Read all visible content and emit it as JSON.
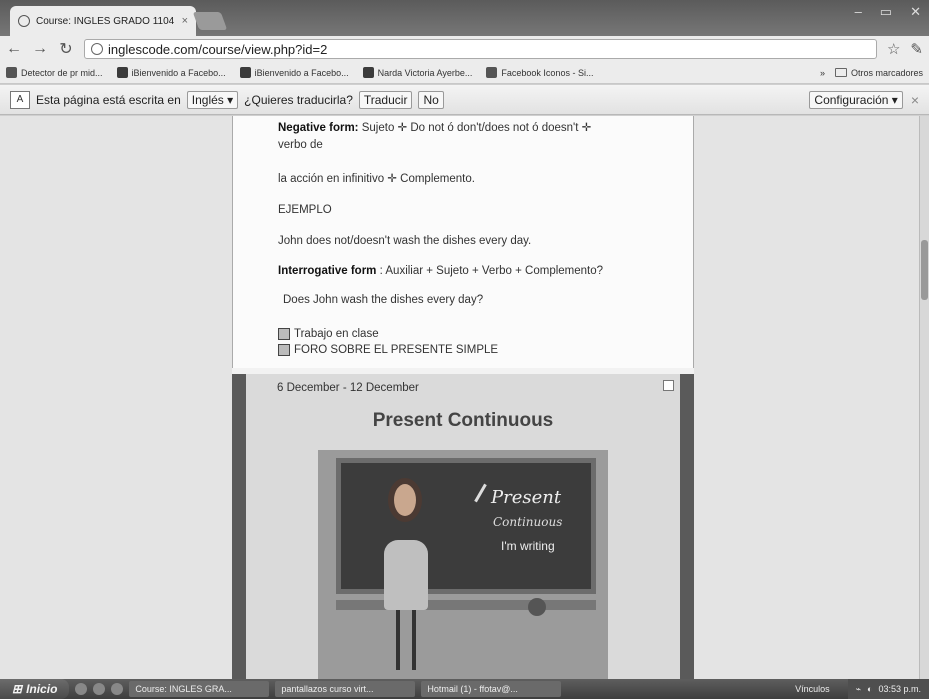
{
  "browser": {
    "tab_title": "Course: INGLES GRADO 1104",
    "tab_close": "×",
    "url": "inglescode.com/course/view.php?id=2",
    "bookmarks": [
      "Detector de pr mid...",
      "iBienvenido a Facebo...",
      "iBienvenido a Facebo...",
      "Narda Victoria Ayerbe...",
      "Facebook Iconos - Si..."
    ],
    "bookmarks_more": "»",
    "other_bookmarks": "Otros marcadores"
  },
  "translate_bar": {
    "icon_text": "A",
    "message": "Esta página está escrita en",
    "language": "Inglés ▾",
    "question": "¿Quieres traducirla?",
    "translate_button": "Traducir",
    "no_button": "No",
    "settings_button": "Configuración ▾",
    "close": "×"
  },
  "section1": {
    "neg_label": "Negative form:",
    "neg_text": " Sujeto ✛ Do not ó don't/does not ó doesn't ✛",
    "neg_text2": "verbo de",
    "line3": "la acción en infinitivo ✛ Complemento.",
    "example_heading": "EJEMPLO",
    "example_line": "John does not/doesn't wash the dishes every day.",
    "int_label": "Interrogative form",
    "int_text": " : Auxiliar + Sujeto + Verbo + Complemento?",
    "int_example": "Does John wash the dishes every day?",
    "resources": [
      "Trabajo en clase",
      "FORO SOBRE EL PRESENTE SIMPLE"
    ]
  },
  "section2": {
    "date_range": "6 December - 12 December",
    "title": "Present Continuous",
    "board_present": "Present",
    "board_continuous": "Continuous",
    "board_writing": "I'm writing"
  },
  "taskbar": {
    "start": "Inicio",
    "tasks": [
      "Course: INGLES GRA...",
      "pantallazos curso virt...",
      "Hotmail (1) - ffotav@..."
    ],
    "tray_label": "Vínculos",
    "clock": "03:53 p.m."
  }
}
